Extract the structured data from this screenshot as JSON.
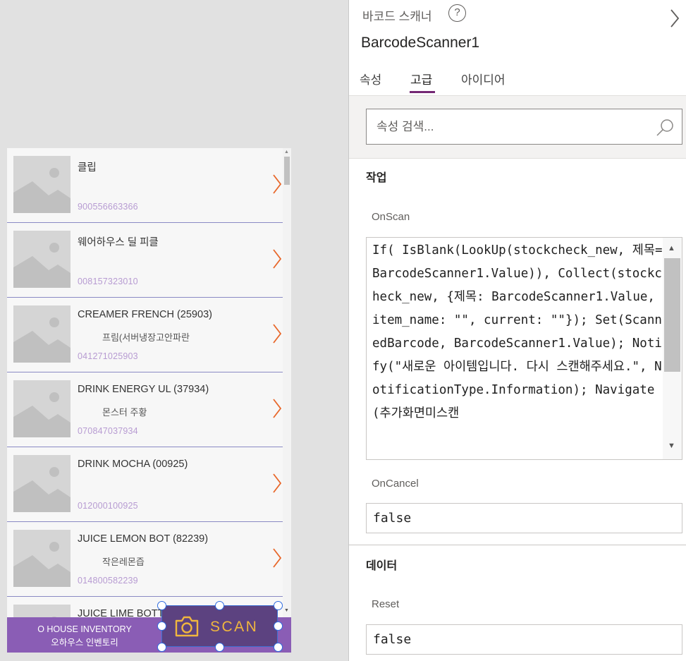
{
  "app": {
    "items": [
      {
        "title": "클립",
        "subtitle": "",
        "code": "900556663366"
      },
      {
        "title": "웨어하우스 딜 피클",
        "subtitle": "",
        "code": "008157323010"
      },
      {
        "title": "CREAMER FRENCH (25903)",
        "subtitle": "프림(서버냉장고안파란",
        "code": "041271025903"
      },
      {
        "title": "DRINK ENERGY UL (37934)",
        "subtitle": "몬스터 주황",
        "code": "070847037934"
      },
      {
        "title": "DRINK MOCHA (00925)",
        "subtitle": "",
        "code": "012000100925"
      },
      {
        "title": "JUICE LEMON BOT (82239)",
        "subtitle": "작은레몬즙",
        "code": "014800582239"
      },
      {
        "title": "JUICE LIME BOTT",
        "subtitle": "",
        "code": ""
      }
    ],
    "footer_line1": "O HOUSE INVENTORY",
    "footer_line2": "오하우스 인벤토리",
    "scan_label": "SCAN",
    "accent": "#8a5db5",
    "chevron_color": "#e8672a"
  },
  "pane": {
    "control_kind": "바코드 스캐너",
    "help_glyph": "?",
    "control_name": "BarcodeScanner1",
    "tabs": [
      {
        "label": "속성"
      },
      {
        "label": "고급",
        "active": true
      },
      {
        "label": "아이디어"
      }
    ],
    "search_placeholder": "속성 검색...",
    "sections": {
      "actions": "작업",
      "data": "데이터"
    },
    "properties": {
      "onscan_label": "OnScan",
      "onscan_value": "If( IsBlank(LookUp(stockcheck_new, 제목=BarcodeScanner1.Value)), Collect(stockcheck_new, {제목: BarcodeScanner1.Value, item_name: \"\", current: \"\"}); Set(ScannedBarcode, BarcodeScanner1.Value); Notify(\"새로운 아이템입니다. 다시 스캔해주세요.\", NotificationType.Information); Navigate(추가화면미스캔",
      "oncancel_label": "OnCancel",
      "oncancel_value": "false",
      "reset_label": "Reset",
      "reset_value": "false"
    },
    "accent": "#742774"
  }
}
